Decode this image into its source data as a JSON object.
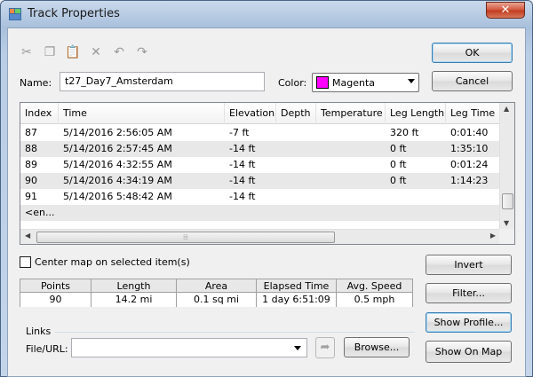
{
  "window": {
    "title": "Track Properties"
  },
  "toolbar": {
    "icons": [
      "cut-icon",
      "copy-icon",
      "paste-icon",
      "delete-icon",
      "undo-icon",
      "redo-icon"
    ]
  },
  "buttons": {
    "ok": "OK",
    "cancel": "Cancel",
    "invert": "Invert",
    "filter": "Filter...",
    "show_profile": "Show Profile...",
    "show_on_map": "Show On Map",
    "browse": "Browse..."
  },
  "name": {
    "label": "Name:",
    "value": "t27_Day7_Amsterdam"
  },
  "color": {
    "label": "Color:",
    "value": "Magenta",
    "swatch": "#ff00ff"
  },
  "table": {
    "columns": [
      "Index",
      "Time",
      "Elevation",
      "Depth",
      "Temperature",
      "Leg Length",
      "Leg Time"
    ],
    "rows": [
      [
        "87",
        "5/14/2016 2:56:05 AM",
        "-7 ft",
        "",
        "",
        "320 ft",
        "0:01:40"
      ],
      [
        "88",
        "5/14/2016 2:57:45 AM",
        "-14 ft",
        "",
        "",
        "0 ft",
        "1:35:10"
      ],
      [
        "89",
        "5/14/2016 4:32:55 AM",
        "-14 ft",
        "",
        "",
        "0 ft",
        "0:01:24"
      ],
      [
        "90",
        "5/14/2016 4:34:19 AM",
        "-14 ft",
        "",
        "",
        "0 ft",
        "1:14:23"
      ],
      [
        "91",
        "5/14/2016 5:48:42 AM",
        "-14 ft",
        "",
        "",
        "",
        ""
      ],
      [
        "<en...",
        "",
        "",
        "",
        "",
        "",
        ""
      ]
    ]
  },
  "center_map": {
    "label": "Center map on selected item(s)"
  },
  "stats": [
    {
      "header": "Points",
      "value": "90"
    },
    {
      "header": "Length",
      "value": "14.2 mi"
    },
    {
      "header": "Area",
      "value": "0.1 sq mi"
    },
    {
      "header": "Elapsed Time",
      "value": "1 day 6:51:09"
    },
    {
      "header": "Avg. Speed",
      "value": "0.5 mph"
    }
  ],
  "links": {
    "group_title": "Links",
    "url_label": "File/URL:",
    "url_value": ""
  }
}
